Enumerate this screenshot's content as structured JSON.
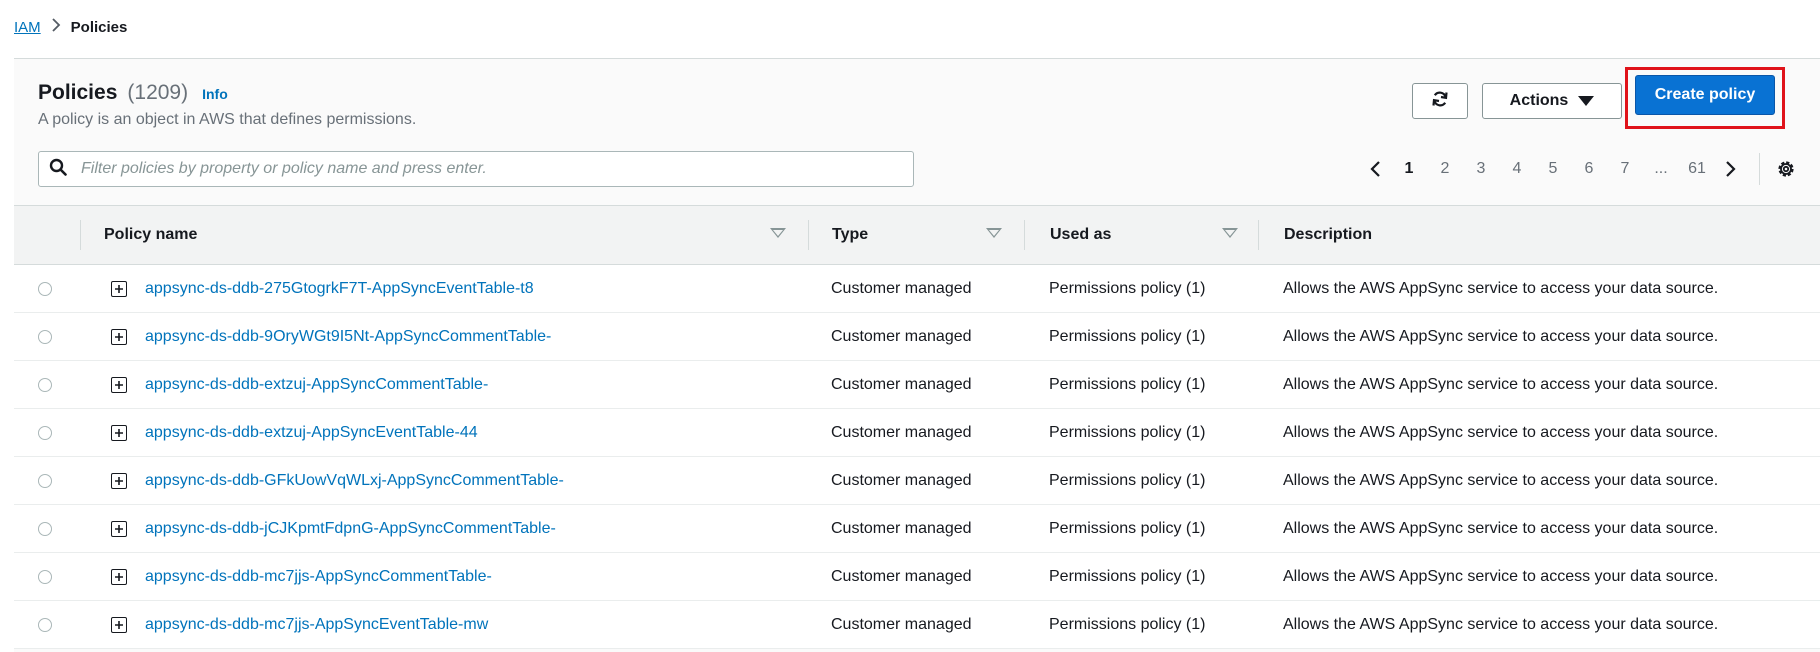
{
  "breadcrumb": {
    "root": "IAM",
    "separator": ">",
    "current": "Policies"
  },
  "header": {
    "title": "Policies",
    "count": "(1209)",
    "info": "Info",
    "subtitle": "A policy is an object in AWS that defines permissions.",
    "actions_label": "Actions",
    "create_label": "Create policy"
  },
  "search": {
    "placeholder": "Filter policies by property or policy name and press enter.",
    "value": ""
  },
  "pagination": {
    "pages": [
      "1",
      "2",
      "3",
      "4",
      "5",
      "6",
      "7"
    ],
    "current": "1",
    "ellipsis": "...",
    "last": "61"
  },
  "table": {
    "columns": [
      "Policy name",
      "Type",
      "Used as",
      "Description"
    ],
    "rows": [
      {
        "name": "appsync-ds-ddb-275GtogrkF7T-AppSyncEventTable-t8",
        "type": "Customer managed",
        "used_as": "Permissions policy (1)",
        "description": "Allows the AWS AppSync service to access your data source."
      },
      {
        "name": "appsync-ds-ddb-9OryWGt9I5Nt-AppSyncCommentTable-",
        "type": "Customer managed",
        "used_as": "Permissions policy (1)",
        "description": "Allows the AWS AppSync service to access your data source."
      },
      {
        "name": "appsync-ds-ddb-extzuj-AppSyncCommentTable-",
        "type": "Customer managed",
        "used_as": "Permissions policy (1)",
        "description": "Allows the AWS AppSync service to access your data source."
      },
      {
        "name": "appsync-ds-ddb-extzuj-AppSyncEventTable-44",
        "type": "Customer managed",
        "used_as": "Permissions policy (1)",
        "description": "Allows the AWS AppSync service to access your data source."
      },
      {
        "name": "appsync-ds-ddb-GFkUowVqWLxj-AppSyncCommentTable-",
        "type": "Customer managed",
        "used_as": "Permissions policy (1)",
        "description": "Allows the AWS AppSync service to access your data source."
      },
      {
        "name": "appsync-ds-ddb-jCJKpmtFdpnG-AppSyncCommentTable-",
        "type": "Customer managed",
        "used_as": "Permissions policy (1)",
        "description": "Allows the AWS AppSync service to access your data source."
      },
      {
        "name": "appsync-ds-ddb-mc7jjs-AppSyncCommentTable-",
        "type": "Customer managed",
        "used_as": "Permissions policy (1)",
        "description": "Allows the AWS AppSync service to access your data source."
      },
      {
        "name": "appsync-ds-ddb-mc7jjs-AppSyncEventTable-mw",
        "type": "Customer managed",
        "used_as": "Permissions policy (1)",
        "description": "Allows the AWS AppSync service to access your data source."
      }
    ]
  },
  "colors": {
    "link": "#0073bb",
    "primary_button": "#0972d3",
    "highlight": "#e0131a"
  },
  "icons": {
    "breadcrumb_separator": "chevron-right-icon",
    "refresh": "refresh-icon",
    "actions_caret": "caret-down-icon",
    "search": "search-icon",
    "prev": "chevron-left-icon",
    "next": "chevron-right-icon",
    "settings": "gear-icon",
    "sort": "sort-down-icon",
    "expand": "expand-plus-icon"
  }
}
